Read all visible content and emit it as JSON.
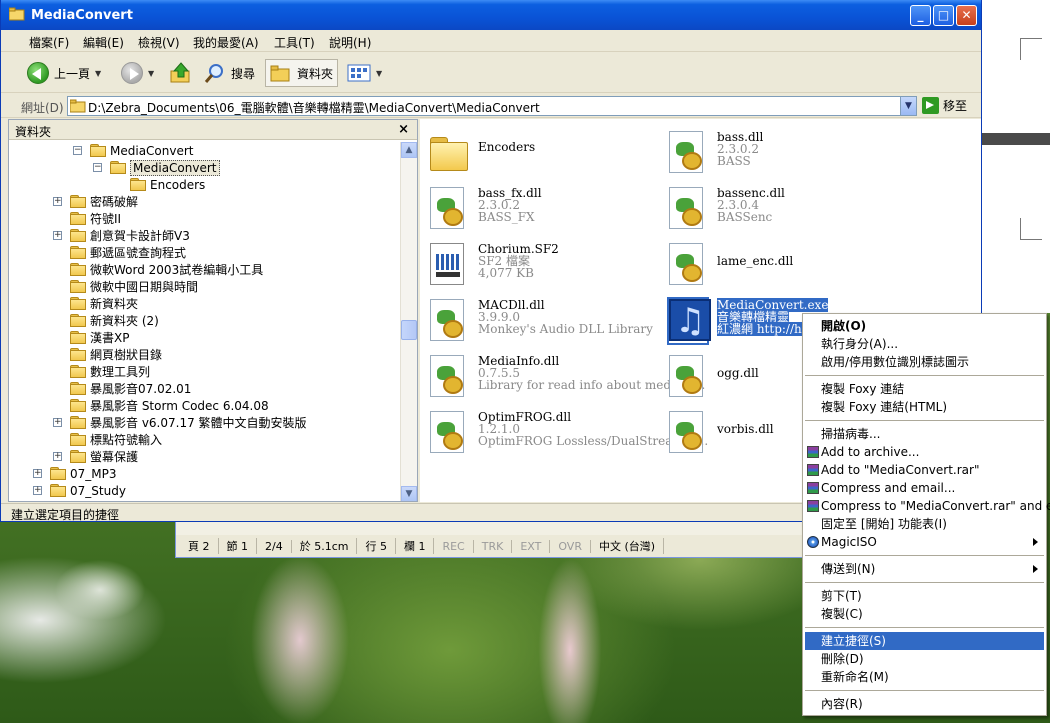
{
  "window": {
    "title": "MediaConvert",
    "min": "0",
    "max": "1",
    "close": "r"
  },
  "menu": [
    "檔案(F)",
    "編輯(E)",
    "檢視(V)",
    "我的最愛(A)",
    "工具(T)",
    "說明(H)"
  ],
  "toolbar": {
    "back": "上一頁",
    "search": "搜尋",
    "folders": "資料夾"
  },
  "address": {
    "label": "網址(D)",
    "path": "D:\\Zebra_Documents\\06_電腦軟體\\音樂轉檔精靈\\MediaConvert\\MediaConvert",
    "go": "移至"
  },
  "tree": {
    "header": "資料夾",
    "close": "×",
    "nodes": [
      {
        "label": "MediaConvert",
        "pm": "−"
      },
      {
        "label": "MediaConvert",
        "pm": "−"
      },
      {
        "label": "Encoders",
        "pm": ""
      },
      {
        "label": "密碼破解",
        "pm": "+"
      },
      {
        "label": "符號II",
        "pm": ""
      },
      {
        "label": "創意賀卡設計師V3",
        "pm": "+"
      },
      {
        "label": "郵遞區號查詢程式",
        "pm": ""
      },
      {
        "label": "微軟Word 2003試卷編輯小工具",
        "pm": ""
      },
      {
        "label": "微軟中國日期與時間",
        "pm": ""
      },
      {
        "label": "新資料夾",
        "pm": ""
      },
      {
        "label": "新資料夾 (2)",
        "pm": ""
      },
      {
        "label": "漢書XP",
        "pm": ""
      },
      {
        "label": "網頁樹狀目錄",
        "pm": ""
      },
      {
        "label": "數理工具列",
        "pm": ""
      },
      {
        "label": "暴風影音07.02.01",
        "pm": ""
      },
      {
        "label": "暴風影音 Storm Codec  6.04.08",
        "pm": ""
      },
      {
        "label": "暴風影音 v6.07.17 繁體中文自動安裝版",
        "pm": "+"
      },
      {
        "label": "標點符號輸入",
        "pm": ""
      },
      {
        "label": "螢幕保護",
        "pm": "+"
      },
      {
        "label": "07_MP3",
        "pm": "+"
      },
      {
        "label": "07_Study",
        "pm": "+"
      }
    ]
  },
  "files": [
    {
      "name": "Encoders",
      "line2": "",
      "line3": "",
      "icon": "folder-icon"
    },
    {
      "name": "bass.dll",
      "line2": "2.3.0.2",
      "line3": "BASS",
      "icon": "dll-icon"
    },
    {
      "name": "bass_fx.dll",
      "line2": "2.3.0.2",
      "line3": "BASS_FX",
      "icon": "dll-icon"
    },
    {
      "name": "bassenc.dll",
      "line2": "2.3.0.4",
      "line3": "BASSenc",
      "icon": "dll-icon"
    },
    {
      "name": "Chorium.SF2",
      "line2": "SF2 檔案",
      "line3": "4,077 KB",
      "icon": "sf2-file-icon"
    },
    {
      "name": "lame_enc.dll",
      "line2": "",
      "line3": "",
      "icon": "dll-icon"
    },
    {
      "name": "MACDll.dll",
      "line2": "3.9.9.0",
      "line3": "Monkey's Audio DLL Library",
      "icon": "dll-icon"
    },
    {
      "name": "MediaConvert.exe",
      "line2": "音樂轉檔精靈",
      "line3": "紅濃網 http://hola",
      "icon": "exe-icon"
    },
    {
      "name": "MediaInfo.dll",
      "line2": "0.7.5.5",
      "line3": "Library for read info about media fi...",
      "icon": "dll-icon"
    },
    {
      "name": "ogg.dll",
      "line2": "",
      "line3": "",
      "icon": "dll-icon"
    },
    {
      "name": "OptimFROG.dll",
      "line2": "1.2.1.0",
      "line3": "OptimFROG Lossless/DualStream D...",
      "icon": "dll-icon"
    },
    {
      "name": "vorbis.dll",
      "line2": "",
      "line3": "",
      "icon": "dll-icon"
    }
  ],
  "status": "建立選定項目的捷徑",
  "doc_status": [
    "頁 2",
    "節 1",
    "2/4",
    "於 5.1cm",
    "行 5",
    "欄 1",
    "REC",
    "TRK",
    "EXT",
    "OVR",
    "中文 (台灣)"
  ],
  "context_menu": [
    {
      "label": "開啟(O)",
      "bold": true
    },
    {
      "label": "執行身分(A)..."
    },
    {
      "label": "啟用/停用數位識別標誌圖示"
    },
    {
      "sep": true
    },
    {
      "label": "複製 Foxy 連結"
    },
    {
      "label": "複製 Foxy 連結(HTML)"
    },
    {
      "sep": true
    },
    {
      "label": "掃描病毒..."
    },
    {
      "label": "Add to archive...",
      "icon": "winrar-icon"
    },
    {
      "label": "Add to \"MediaConvert.rar\"",
      "icon": "winrar-icon"
    },
    {
      "label": "Compress and email...",
      "icon": "winrar-icon"
    },
    {
      "label": "Compress to \"MediaConvert.rar\" and email",
      "icon": "winrar-icon"
    },
    {
      "label": "固定至 [開始] 功能表(I)"
    },
    {
      "label": "MagicISO",
      "icon": "magiciso-icon",
      "submenu": true
    },
    {
      "sep": true
    },
    {
      "label": "傳送到(N)",
      "submenu": true
    },
    {
      "sep": true
    },
    {
      "label": "剪下(T)"
    },
    {
      "label": "複製(C)"
    },
    {
      "sep": true
    },
    {
      "label": "建立捷徑(S)",
      "highlight": true
    },
    {
      "label": "刪除(D)"
    },
    {
      "label": "重新命名(M)"
    },
    {
      "sep": true
    },
    {
      "label": "內容(R)"
    }
  ]
}
